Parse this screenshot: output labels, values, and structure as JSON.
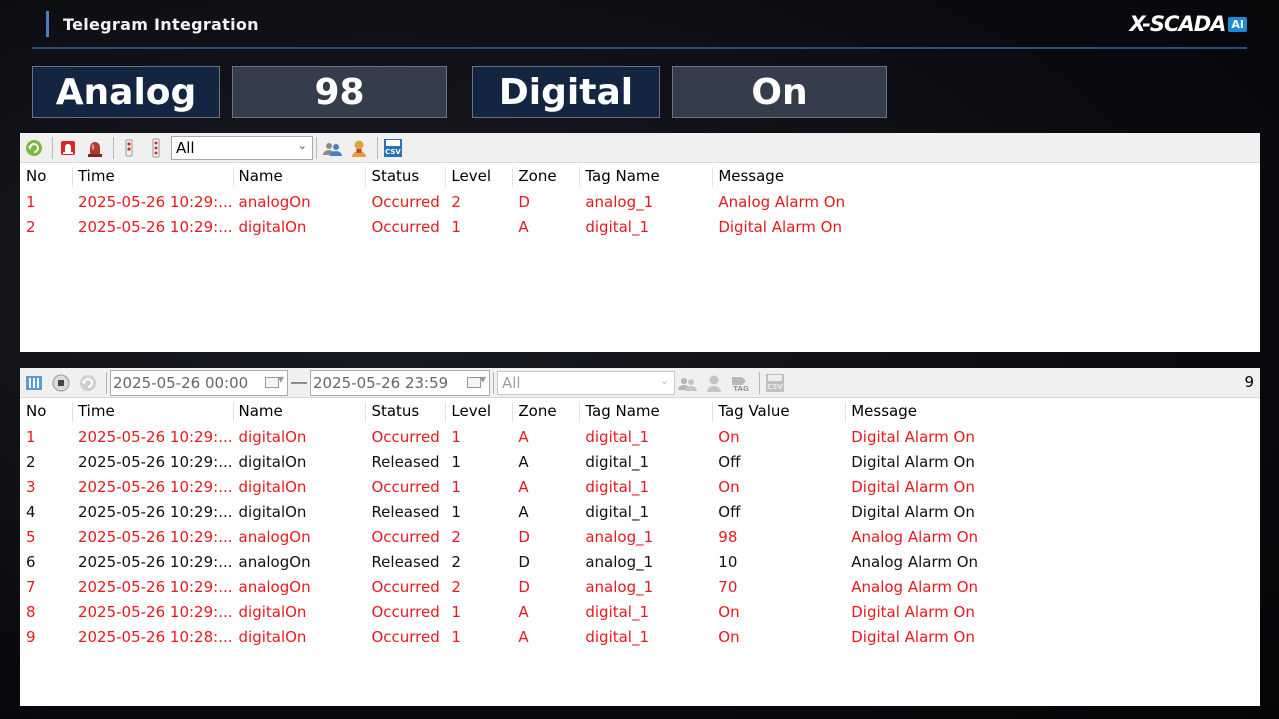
{
  "header": {
    "title": "Telegram Integration",
    "logo_text": "X-SCADA",
    "logo_badge": "AI"
  },
  "tiles": [
    {
      "label": "Analog",
      "value": "98"
    },
    {
      "label": "Digital",
      "value": "On"
    }
  ],
  "colors": {
    "occurred": "#e8191c",
    "released": "#111111",
    "tile_label_bg": "#132540",
    "tile_value_bg": "#343d4c",
    "header_line": "#2b4f78"
  },
  "alarm_panel": {
    "filter_value": "All",
    "columns": [
      "No",
      "Time",
      "Name",
      "Status",
      "Level",
      "Zone",
      "Tag Name",
      "Message"
    ],
    "rows": [
      {
        "no": "1",
        "time": "2025-05-26 10:29:...",
        "name": "analogOn",
        "status": "Occurred",
        "level": "2",
        "zone": "D",
        "tag_name": "analog_1",
        "message": "Analog Alarm On"
      },
      {
        "no": "2",
        "time": "2025-05-26 10:29:...",
        "name": "digitalOn",
        "status": "Occurred",
        "level": "1",
        "zone": "A",
        "tag_name": "digital_1",
        "message": "Digital Alarm On"
      }
    ]
  },
  "history_panel": {
    "date_from": "2025-05-26 00:00",
    "date_to": "2025-05-26 23:59",
    "date_separator": "—",
    "filter_value": "All",
    "count": "9",
    "columns": [
      "No",
      "Time",
      "Name",
      "Status",
      "Level",
      "Zone",
      "Tag Name",
      "Tag Value",
      "Message"
    ],
    "rows": [
      {
        "no": "1",
        "time": "2025-05-26 10:29:...",
        "name": "digitalOn",
        "status": "Occurred",
        "level": "1",
        "zone": "A",
        "tag_name": "digital_1",
        "tag_value": "On",
        "message": "Digital Alarm On"
      },
      {
        "no": "2",
        "time": "2025-05-26 10:29:...",
        "name": "digitalOn",
        "status": "Released",
        "level": "1",
        "zone": "A",
        "tag_name": "digital_1",
        "tag_value": "Off",
        "message": "Digital Alarm On"
      },
      {
        "no": "3",
        "time": "2025-05-26 10:29:...",
        "name": "digitalOn",
        "status": "Occurred",
        "level": "1",
        "zone": "A",
        "tag_name": "digital_1",
        "tag_value": "On",
        "message": "Digital Alarm On"
      },
      {
        "no": "4",
        "time": "2025-05-26 10:29:...",
        "name": "digitalOn",
        "status": "Released",
        "level": "1",
        "zone": "A",
        "tag_name": "digital_1",
        "tag_value": "Off",
        "message": "Digital Alarm On"
      },
      {
        "no": "5",
        "time": "2025-05-26 10:29:...",
        "name": "analogOn",
        "status": "Occurred",
        "level": "2",
        "zone": "D",
        "tag_name": "analog_1",
        "tag_value": "98",
        "message": "Analog Alarm On"
      },
      {
        "no": "6",
        "time": "2025-05-26 10:29:...",
        "name": "analogOn",
        "status": "Released",
        "level": "2",
        "zone": "D",
        "tag_name": "analog_1",
        "tag_value": "10",
        "message": "Analog Alarm On"
      },
      {
        "no": "7",
        "time": "2025-05-26 10:29:...",
        "name": "analogOn",
        "status": "Occurred",
        "level": "2",
        "zone": "D",
        "tag_name": "analog_1",
        "tag_value": "70",
        "message": "Analog Alarm On"
      },
      {
        "no": "8",
        "time": "2025-05-26 10:29:...",
        "name": "digitalOn",
        "status": "Occurred",
        "level": "1",
        "zone": "A",
        "tag_name": "digital_1",
        "tag_value": "On",
        "message": "Digital Alarm On"
      },
      {
        "no": "9",
        "time": "2025-05-26 10:28:...",
        "name": "digitalOn",
        "status": "Occurred",
        "level": "1",
        "zone": "A",
        "tag_name": "digital_1",
        "tag_value": "On",
        "message": "Digital Alarm On"
      }
    ]
  },
  "icons": {
    "alarm_toolbar": [
      "refresh-icon",
      "alarm-bell-icon",
      "alarm-lamp-icon",
      "ack-single-icon",
      "ack-all-icon",
      "user-group-icon",
      "user-icon",
      "csv-export-icon"
    ],
    "history_toolbar": [
      "view-columns-icon",
      "stop-icon",
      "refresh-icon",
      "user-group-icon",
      "user-icon",
      "tag-icon",
      "csv-export-icon"
    ]
  }
}
